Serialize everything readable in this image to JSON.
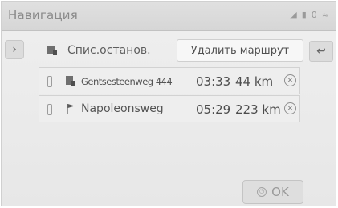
{
  "header": {
    "title": "Навигация",
    "status_signal": "◢",
    "status_lock": "▮",
    "status_count": "0",
    "status_wifi": "≈"
  },
  "toolbar": {
    "expand_label": "›",
    "list_label": "Спис.останов.",
    "delete_route_label": "Удалить маршрут",
    "back_label": "↩"
  },
  "stops": [
    {
      "name": "Gentsesteenweg 444",
      "time": "03:33",
      "distance": "44 km",
      "icon": "waypoint-icon"
    },
    {
      "name": "Napoleonsweg",
      "time": "05:29",
      "distance": "223 km",
      "icon": "flag-icon"
    }
  ],
  "footer": {
    "ok_label": "OK"
  }
}
